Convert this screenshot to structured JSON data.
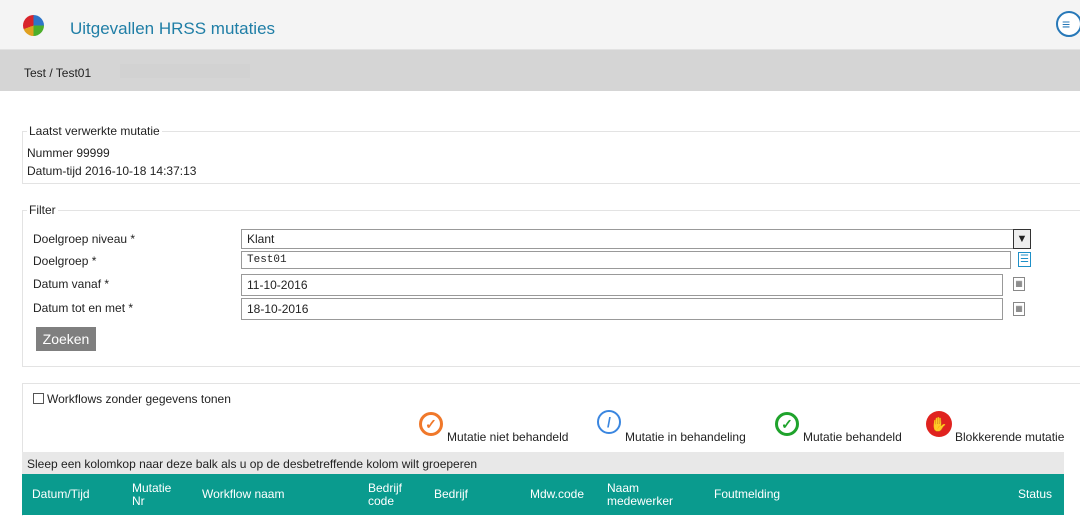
{
  "app": {
    "title": "Uitgevallen HRSS mutaties"
  },
  "breadcrumb": "Test / Test01",
  "last_mutation": {
    "legend": "Laatst verwerkte mutatie",
    "nummer": "Nummer  99999",
    "datum_tijd": "Datum-tijd 2016-10-18 14:37:13"
  },
  "filter": {
    "legend": "Filter",
    "doelgroep_niveau_label": "Doelgroep niveau *",
    "doelgroep_niveau_value": "Klant",
    "doelgroep_label": "Doelgroep *",
    "doelgroep_value": "Test01",
    "datum_vanaf_label": "Datum vanaf *",
    "datum_vanaf_value": "11-10-2016",
    "datum_tot_label": "Datum tot en met *",
    "datum_tot_value": "18-10-2016",
    "search_button": "Zoeken"
  },
  "workflows_checkbox_label": "Workflows zonder gegevens tonen",
  "status_legend": [
    {
      "label": "Mutatie niet behandeld",
      "icon": "check-circle-orange-icon",
      "color": "#f0782a"
    },
    {
      "label": "Mutatie in behandeling",
      "icon": "pencil-circle-blue-icon",
      "color": "#3a86e0"
    },
    {
      "label": "Mutatie behandeld",
      "icon": "check-circle-green-icon",
      "color": "#1fa32c"
    },
    {
      "label": "Blokkerende mutatie",
      "icon": "stop-hand-red-icon",
      "color": "#e0231f"
    }
  ],
  "group_bar_text": "Sleep een kolomkop naar deze balk als u op de desbetreffende kolom wilt groeperen",
  "table": {
    "columns": [
      "Datum/Tijd",
      "Mutatie Nr",
      "Workflow naam",
      "Bedrijf code",
      "Bedrijf",
      "Mdw.code",
      "Naam medewerker",
      "Foutmelding",
      "Status"
    ]
  },
  "colors": {
    "header_teal": "#0a9b8e",
    "title_blue": "#1f7ea6"
  }
}
